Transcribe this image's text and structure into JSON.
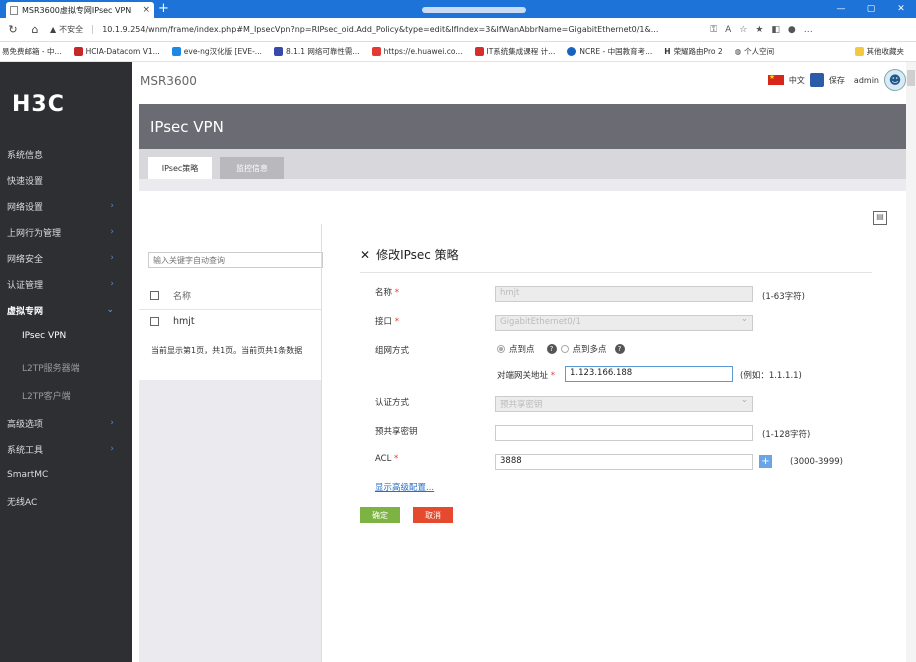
{
  "browser": {
    "tab_title": "MSR3600虚拟专网IPsec VPN",
    "tab_close": "×",
    "new_tab": "+",
    "window_buttons": [
      "—",
      "▢",
      "✕"
    ],
    "security": "不安全",
    "url": "10.1.9.254/wnm/frame/index.php#M_IpsecVpn?np=RIPsec_oid.Add_Policy&type=edit&IfIndex=3&IfWanAbbrName=GigabitEthernet0/1&...",
    "bookmarks": [
      "易免费邮箱 - 中...",
      "HCIA-Datacom V1...",
      "eve-ng汉化版 [EVE-...",
      "8.1.1 网络可靠性需...",
      "https://e.huawei.co...",
      "IT系统集成课程 计...",
      "NCRE - 中国教育考...",
      "荣耀路由Pro 2",
      "个人空间"
    ],
    "other_bookmarks": "其他收藏夹"
  },
  "app": {
    "logo": "H3C",
    "brand": "MSR3600",
    "lang": "中文",
    "save": "保存",
    "user": "admin",
    "page_title": "IPsec VPN",
    "tabs": [
      "IPsec策略",
      "监控信息"
    ]
  },
  "sidebar": {
    "items": [
      "系统信息",
      "快速设置",
      "网络设置",
      "上网行为管理",
      "网络安全",
      "认证管理",
      "虚拟专网",
      "IPsec VPN",
      "L2TP服务器端",
      "L2TP客户端",
      "高级选项",
      "系统工具",
      "SmartMC",
      "无线AC"
    ]
  },
  "list": {
    "search_placeholder": "输入关键字自动查询",
    "col_name": "名称",
    "rows": [
      "hmjt"
    ],
    "footer": "当前显示第1页，共1页。当前页共1条数据"
  },
  "form": {
    "close": "✕",
    "title": "修改IPsec 策略",
    "name_label": "名称",
    "name_value": "hmjt",
    "name_hint": "(1-63字符)",
    "iface_label": "接口",
    "iface_value": "GigabitEthernet0/1",
    "mode_label": "组网方式",
    "mode_p2p": "点到点",
    "mode_p2mp": "点到多点",
    "peer_label": "对端网关地址",
    "peer_value": "1.123.166.188",
    "peer_hint": "(例如：1.1.1.1)",
    "auth_label": "认证方式",
    "auth_value": "预共享密钥",
    "psk_label": "预共享密钥",
    "psk_value": "",
    "psk_hint": "(1-128字符)",
    "acl_label": "ACL",
    "acl_value": "3888",
    "acl_hint": "(3000-3999)",
    "advanced": "显示高级配置...",
    "ok": "确定",
    "cancel": "取消",
    "required_mark": "*",
    "help_mark": "?"
  },
  "colors": {
    "header": "#6b6b73",
    "sidebar": "#2d2f33",
    "ok": "#7cb342",
    "cancel": "#e64a2e",
    "link": "#2a6fc4"
  }
}
